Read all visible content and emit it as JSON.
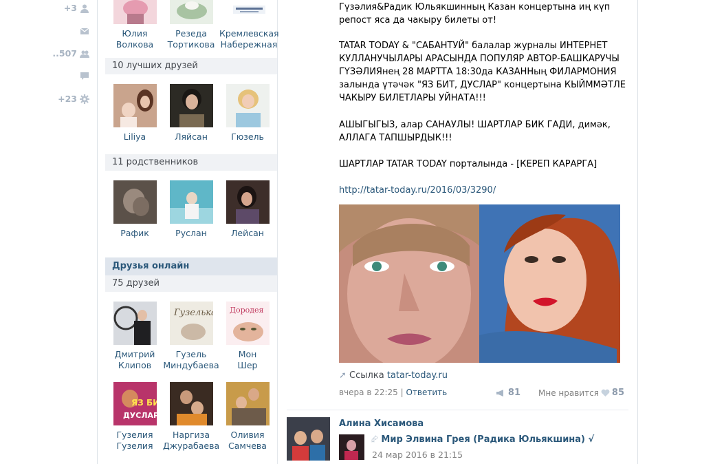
{
  "left_rail": [
    {
      "count": "+3",
      "icon": "person-icon"
    },
    {
      "count": "",
      "icon": "mail-icon"
    },
    {
      "count": "..507",
      "icon": "group-icon"
    },
    {
      "count": "",
      "icon": "chat-icon"
    },
    {
      "count": "+23",
      "icon": "gear-icon"
    }
  ],
  "top_friends": [
    {
      "first": "Юлия",
      "last": "Волкова"
    },
    {
      "first": "Резеда",
      "last": "Тортикова"
    },
    {
      "first": "Кремлевская",
      "last": "Набережная"
    }
  ],
  "section_best": "10 лучших друзей",
  "best_friends": [
    {
      "first": "Liliya"
    },
    {
      "first": "Ляйсан"
    },
    {
      "first": "Гюзель"
    }
  ],
  "section_relatives": "11 родственников",
  "relatives": [
    {
      "first": "Рафик"
    },
    {
      "first": "Руслан"
    },
    {
      "first": "Лейсан"
    }
  ],
  "section_online": "Друзья онлайн",
  "section_friends_count": "75 друзей",
  "friends": [
    {
      "first": "Дмитрий",
      "last": "Клипов"
    },
    {
      "first": "Гузель",
      "last": "Миндубаева"
    },
    {
      "first": "Мон",
      "last": "Шер"
    },
    {
      "first": "Гузелия",
      "last": "Гузелия"
    },
    {
      "first": "Наргиза",
      "last": "Джурабаева"
    },
    {
      "first": "Оливия",
      "last": "Самчева"
    }
  ],
  "post": {
    "line1": "Гүзәлия&Радик Юльякшинның Казан концертына иң күп",
    "line2": "репост яса да чакыру билеты от!",
    "para2": [
      "TATAR TODAY & \"САБАНТУЙ\" балалар журналы ИНТЕРНЕТ",
      "КУЛЛАНУЧЫЛАРЫ АРАСЫНДА ПОПУЛЯР АВТОР-БАШКАРУЧЫ",
      "ГҮЗӘЛИЯнең 28 МАРТТА 18:30да КАЗАННың ФИЛАРМОНИЯ",
      "залында үтәчәк \"ЯЗ БИТ, ДУСЛАР\" концертына КЫЙММӘТЛЕ",
      "ЧАКЫРУ БИЛЕТЛАРЫ УЙНАТА!!!"
    ],
    "para3": [
      "АШЫГЫГЫЗ, алар САНАУЛЫ! ШАРТЛАР БИК ГАДИ, димәк,",
      "АЛЛАГА ТАПШЫРДЫК!!!"
    ],
    "para4": "ШАРТЛАР TATAR TODAY порталында - [КЕРЕП КАРАРГА]",
    "url": "http://tatar-today.ru/2016/03/3290/",
    "link_label": "Ссылка",
    "link_domain": "tatar-today.ru",
    "time": "вчера в 22:25",
    "reply": "Ответить",
    "shares": "81",
    "likes_label": "Мне нравится",
    "likes": "85"
  },
  "next_post": {
    "author": "Алина Хисамова",
    "repost_from": "Мир Элвина Грея (Радика Юльякшина) √",
    "time": "24 мар 2016 в 21:15"
  },
  "colors": {
    "link": "#2b587a",
    "header_bg": "#f0f2f5",
    "online_bg": "#dfe5ed",
    "muted": "#828282"
  }
}
